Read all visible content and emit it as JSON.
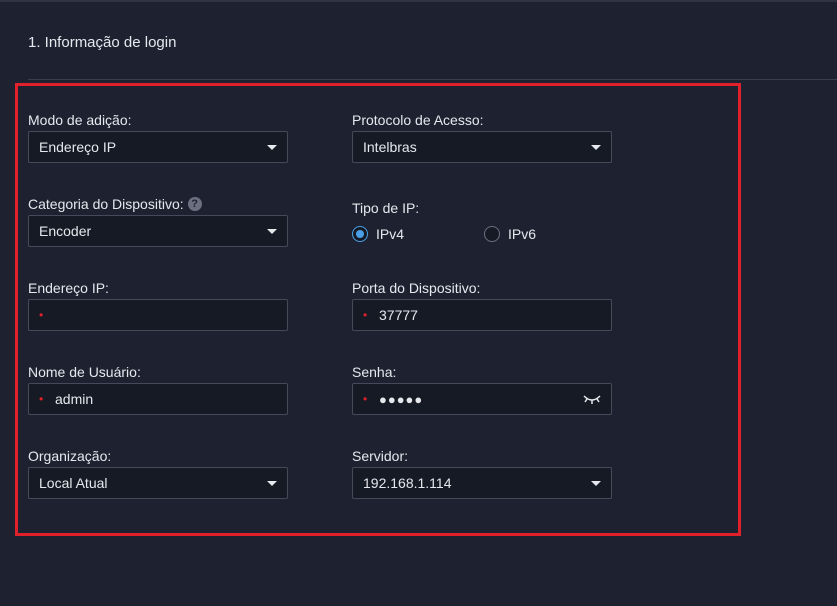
{
  "section": {
    "title": "1. Informação de login"
  },
  "fields": {
    "add_mode": {
      "label": "Modo de adição:",
      "value": "Endereço IP"
    },
    "access_protocol": {
      "label": "Protocolo de Acesso:",
      "value": "Intelbras"
    },
    "device_category": {
      "label": "Categoria do Dispositivo:",
      "value": "Encoder",
      "help_icon": "?"
    },
    "ip_type": {
      "label": "Tipo de IP:",
      "options": [
        "IPv4",
        "IPv6"
      ],
      "selected": "IPv4"
    },
    "ip_address": {
      "label": "Endereço IP:",
      "value": "",
      "required": true
    },
    "device_port": {
      "label": "Porta do Dispositivo:",
      "value": "37777",
      "required": true
    },
    "username": {
      "label": "Nome de Usuário:",
      "value": "admin",
      "required": true
    },
    "password": {
      "label": "Senha:",
      "value": "●●●●●",
      "required": true
    },
    "organization": {
      "label": "Organização:",
      "value": "Local Atual"
    },
    "server": {
      "label": "Servidor:",
      "value": "192.168.1.114"
    }
  },
  "colors": {
    "background": "#1e2230",
    "input_background": "#161a24",
    "highlight": "#e0202a",
    "accent": "#4a9fe8"
  },
  "icons": {
    "dropdown": "chevron-down-icon",
    "help": "help-circle-icon",
    "password_toggle": "eye-closed-icon",
    "required": "asterisk-icon"
  }
}
